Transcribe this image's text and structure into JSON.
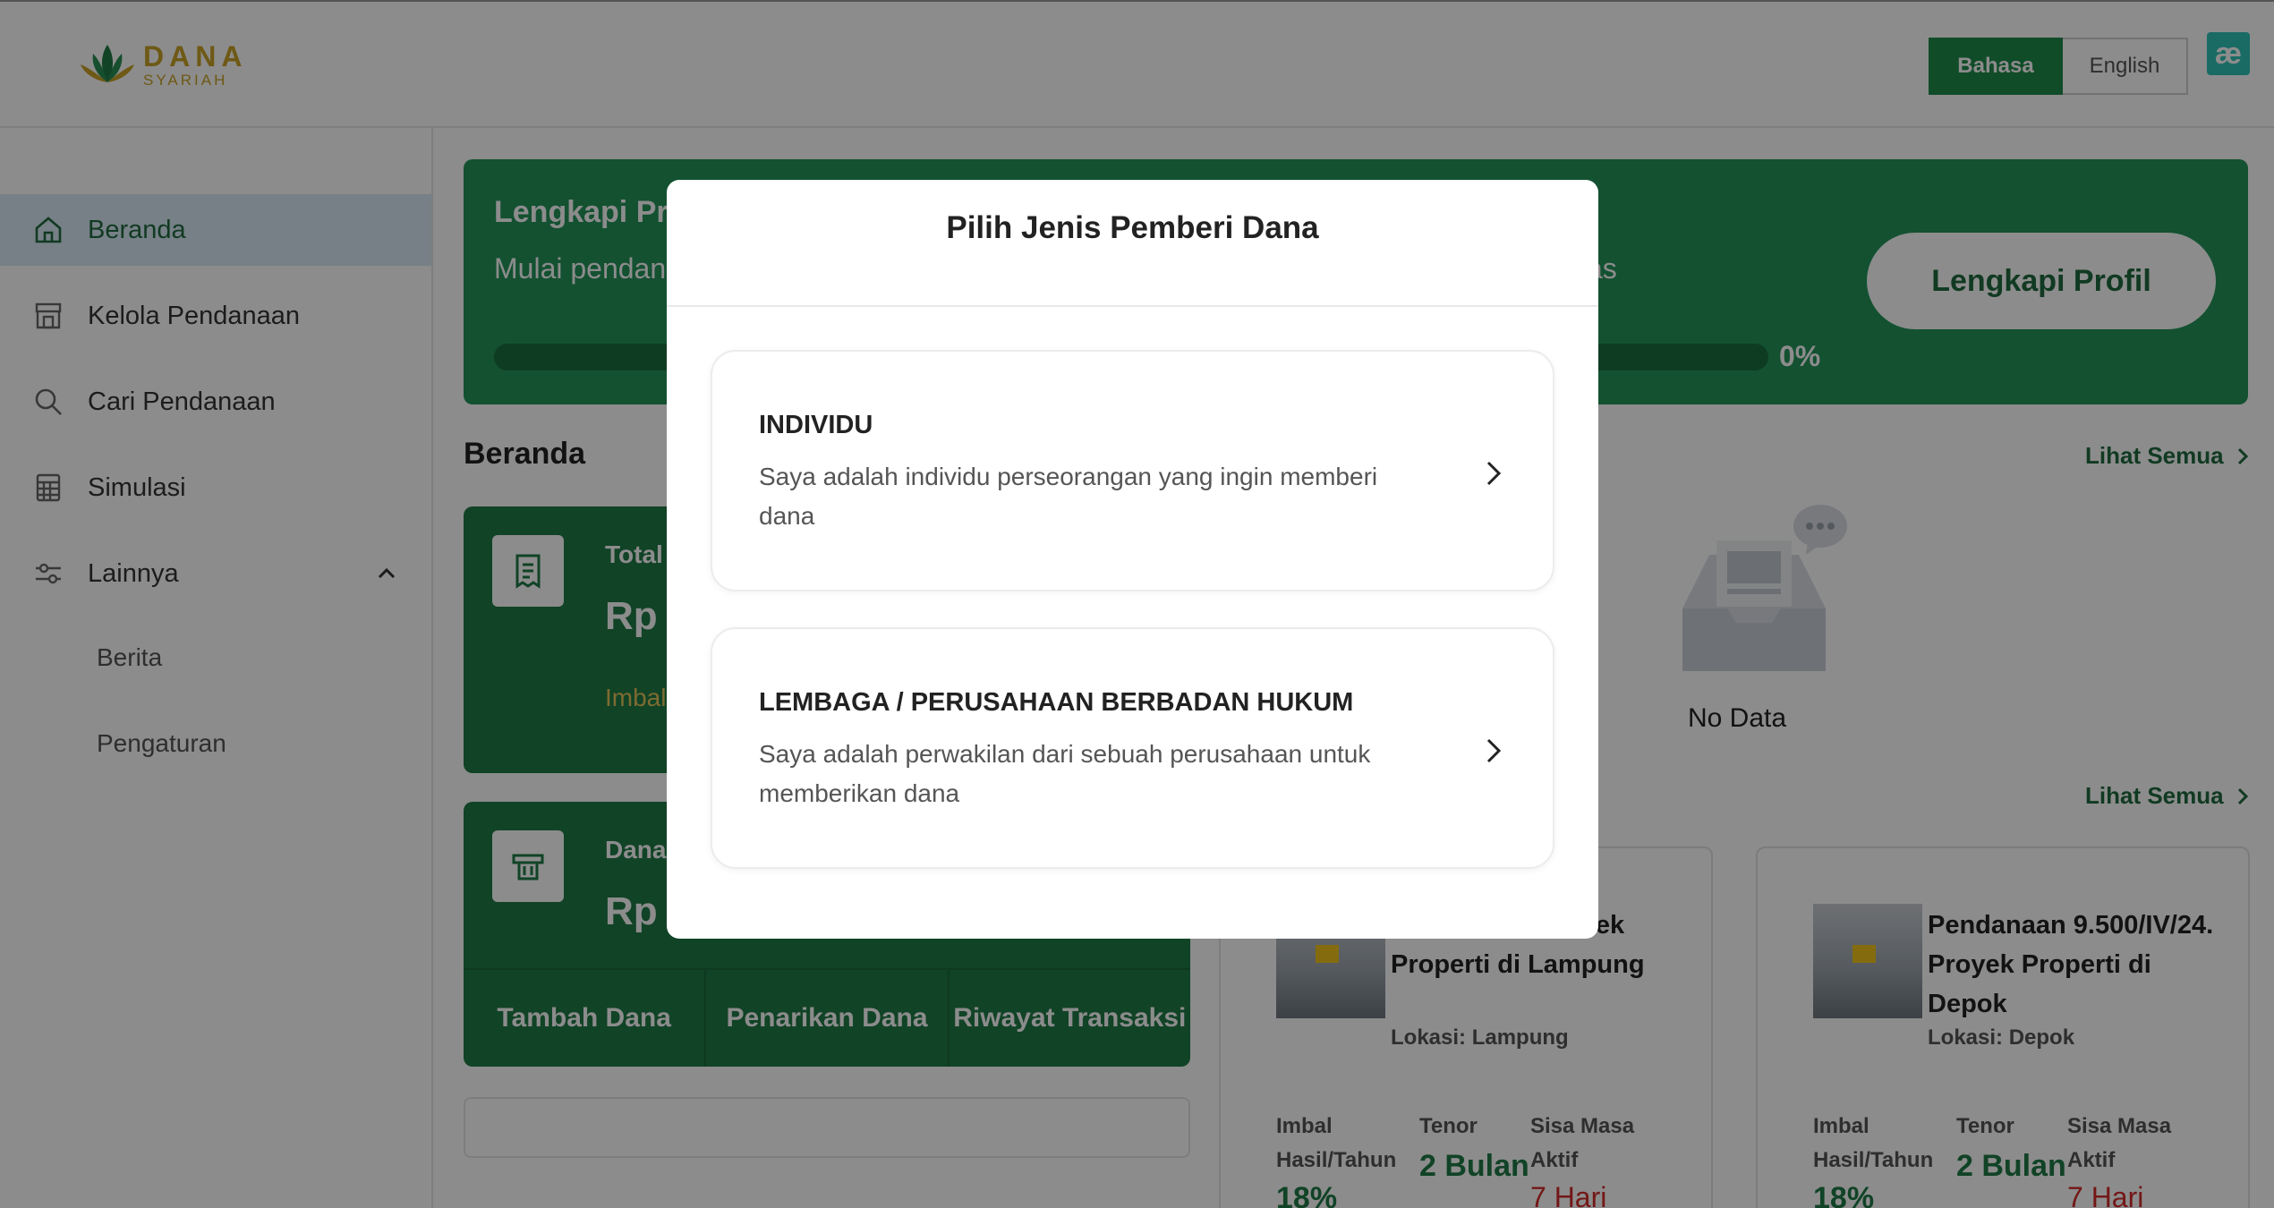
{
  "header": {
    "logo_line1": "DANA",
    "logo_line2": "SYARIAH",
    "lang_active": "Bahasa",
    "lang_inactive": "English",
    "ext_icon": "ae-icon",
    "ext_glyph": "æ"
  },
  "sidebar": {
    "items": [
      {
        "label": "Beranda",
        "icon": "home-icon"
      },
      {
        "label": "Kelola Pendanaan",
        "icon": "store-icon"
      },
      {
        "label": "Cari Pendanaan",
        "icon": "search-icon"
      },
      {
        "label": "Simulasi",
        "icon": "calculator-icon"
      },
      {
        "label": "Lainnya",
        "icon": "sliders-icon"
      }
    ],
    "subitems": [
      "Berita",
      "Pengaturan"
    ]
  },
  "banner": {
    "title": "Lengkapi Pro",
    "subtitle_left": "Mulai pendan",
    "subtitle_right": "as",
    "progress": 0,
    "progress_label": "0%",
    "button": "Lengkapi Profil"
  },
  "home": {
    "title": "Beranda",
    "see_all_1": "Lihat Semua",
    "see_all_2": "Lihat Semua"
  },
  "card_total": {
    "label": "Total",
    "value": "Rp (",
    "note": "Imbal"
  },
  "card_dana": {
    "label": "Dana",
    "value": "Rp (",
    "actions": [
      "Tambah Dana",
      "Penarikan Dana",
      "Riwayat Transaksi"
    ]
  },
  "nodata": "No Data",
  "products": [
    {
      "title": "9.499/IV/24. Proyek Properti di Lampung",
      "location": "Lokasi: Lampung",
      "lbl_imbal": "Imbal Hasil/Tahun",
      "lbl_tenor": "Tenor",
      "lbl_sisa": "Sisa Masa Aktif",
      "imbal": "18%",
      "tenor": "2 Bulan",
      "sisa": "7 Hari"
    },
    {
      "title": "Pendanaan 9.500/IV/24. Proyek Properti di Depok",
      "location": "Lokasi: Depok",
      "lbl_imbal": "Imbal Hasil/Tahun",
      "lbl_tenor": "Tenor",
      "lbl_sisa": "Sisa Masa Aktif",
      "imbal": "18%",
      "tenor": "2 Bulan",
      "sisa": "7 Hari"
    }
  ],
  "modal": {
    "title": "Pilih Jenis Pemberi Dana",
    "options": [
      {
        "title": "INDIVIDU",
        "desc": "Saya adalah individu perseorangan yang ingin memberi dana"
      },
      {
        "title": "LEMBAGA / PERUSAHAAN BERBADAN HUKUM",
        "desc": "Saya adalah perwakilan dari sebuah perusahaan untuk memberikan dana"
      }
    ]
  },
  "colors": {
    "primary": "#1f8a4c",
    "banner": "#23945a",
    "card": "#1f7a46",
    "accent_gold": "#c9a227",
    "danger": "#d42b2b"
  }
}
